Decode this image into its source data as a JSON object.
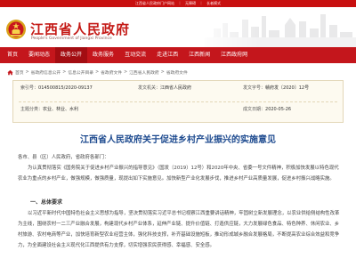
{
  "topbar": {
    "items": [
      "江西省人民政府门户网站",
      "｜",
      "无障碍",
      "｜",
      "长者模式"
    ]
  },
  "header": {
    "title": "江西省人民政府",
    "subtitle": "People's Government of Jiangxi Province",
    "emblem_icon": "national-emblem-icon",
    "brand_color": "#c41a16"
  },
  "nav": {
    "items": [
      "首页",
      "要闻动态",
      "政务公开",
      "政务服务",
      "互动交流",
      "走进江西",
      "江西新闻",
      "江西政府网"
    ],
    "active_index": 2,
    "color": "#c4161c"
  },
  "breadcrumb": {
    "items": [
      "首页",
      "省政府信息公开",
      "信息公开目录",
      "省政府文件",
      "江西省人民政府",
      "省政府文件"
    ],
    "separator": ">"
  },
  "info": {
    "index_label": "索引号：",
    "index_value": "014500815/2020-09137",
    "issuer_label": "发文机关：",
    "issuer_value": "江西省人民政府",
    "docno_label": "发文字号：",
    "docno_value": "赣府发〔2020〕12号",
    "category_label": "主题分类：",
    "category_value": "农业、林业、水利",
    "date_label": "成文日期：",
    "date_value": "2020-05-26"
  },
  "article": {
    "title": "江西省人民政府关于促进乡村产业振兴的实施意见",
    "addressee": "各市、县（区）人民政府，省政府各部门：",
    "para1": "为认真贯彻落实《国务院关于促进乡村产业振兴的指导意见》（国发〔2019〕12号）和2020年中央、省委一号文件精神，积极加快发展以特色现代农业为重点的乡村产业，做强规模，做强质量，现提出如下实施意见。加快新型产业化发展步伐，推进乡村产业高质量发展，促进乡村振兴战略实施。",
    "section1": "一、总体要求",
    "para2": "以习近平新时代中国特色社会主义思想为指导，坚决贯彻落实习近平总书记视察江西重要讲话精神，牢固树立新发展理念，以农业供给侧结构性改革为主线，围绕农村一二三产业融合发展，构建现代乡村产业体系，延伸产业链、提升价值链、打造供应链，大力发展绿色食品、特色种养、休闲农业、乡村旅游、农村电商等产业，加快培育新型农业经营主体，强化科技支撑，补齐基础设施短板，推动形成城乡融合发展格局，不断提高农业综合效益和竞争力，为全面建设社会主义现代化江西提供有力支撑，切实增强农民获得感、幸福感、安全感。"
  }
}
